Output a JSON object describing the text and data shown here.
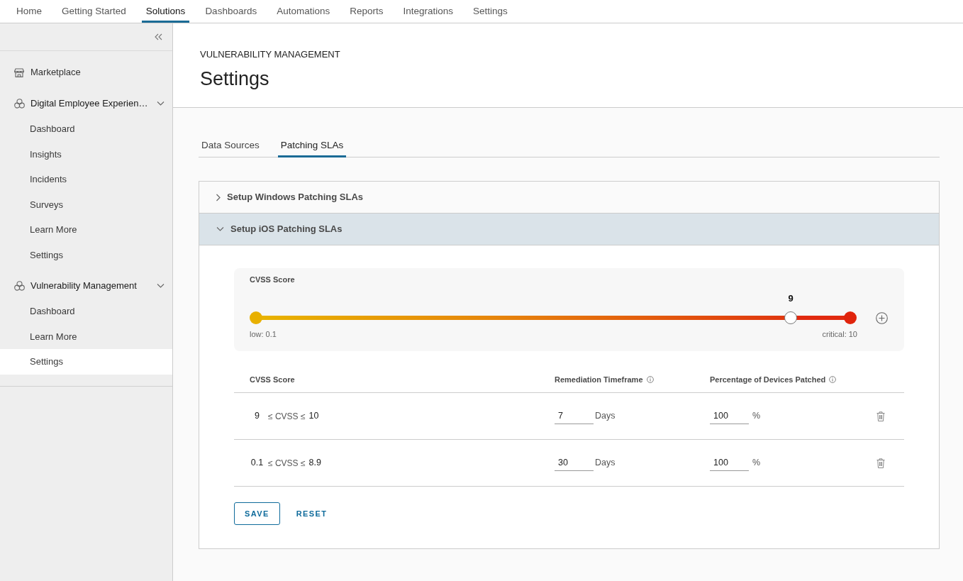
{
  "top_nav": [
    {
      "label": "Home",
      "selected": false
    },
    {
      "label": "Getting Started",
      "selected": false
    },
    {
      "label": "Solutions",
      "selected": true
    },
    {
      "label": "Dashboards",
      "selected": false
    },
    {
      "label": "Automations",
      "selected": false
    },
    {
      "label": "Reports",
      "selected": false
    },
    {
      "label": "Integrations",
      "selected": false
    },
    {
      "label": "Settings",
      "selected": false
    }
  ],
  "sidebar": {
    "items": [
      {
        "kind": "link",
        "label": "Marketplace",
        "selected": false
      },
      {
        "kind": "group",
        "label": "Digital Employee Experien…",
        "expanded": true,
        "children": [
          {
            "label": "Dashboard",
            "selected": false
          },
          {
            "label": "Insights",
            "selected": false
          },
          {
            "label": "Incidents",
            "selected": false
          },
          {
            "label": "Surveys",
            "selected": false
          },
          {
            "label": "Learn More",
            "selected": false
          },
          {
            "label": "Settings",
            "selected": false
          }
        ]
      },
      {
        "kind": "group",
        "label": "Vulnerability Management",
        "expanded": true,
        "children": [
          {
            "label": "Dashboard",
            "selected": false
          },
          {
            "label": "Learn More",
            "selected": false
          },
          {
            "label": "Settings",
            "selected": true
          }
        ]
      }
    ]
  },
  "header": {
    "section": "VULNERABILITY MANAGEMENT",
    "title": "Settings"
  },
  "tabs": [
    {
      "label": "Data Sources",
      "selected": false
    },
    {
      "label": "Patching SLAs",
      "selected": true
    }
  ],
  "accordion": [
    {
      "title": "Setup Windows Patching SLAs",
      "expanded": false
    },
    {
      "title": "Setup iOS Patching SLAs",
      "expanded": true,
      "slider": {
        "label": "CVSS Score",
        "value": "9",
        "level": 0.9,
        "min_label": "low: 0.1",
        "max_label": "critical: 10"
      },
      "table": {
        "columns": [
          {
            "label": "CVSS Score",
            "info": false
          },
          {
            "label": "Remediation Timeframe",
            "info": true
          },
          {
            "label": "Percentage of Devices Patched",
            "info": true
          }
        ],
        "rows": [
          {
            "low": "9",
            "relation": "≤ CVSS ≤",
            "high": "10",
            "days": "7",
            "days_unit": "Days",
            "percent": "100",
            "percent_unit": "%"
          },
          {
            "low": "0.1",
            "relation": "≤ CVSS ≤",
            "high": "8.9",
            "days": "30",
            "days_unit": "Days",
            "percent": "100",
            "percent_unit": "%"
          }
        ]
      },
      "buttons": [
        {
          "label": "SAVE",
          "kind": "outline"
        },
        {
          "label": "RESET",
          "kind": "link"
        }
      ]
    }
  ]
}
